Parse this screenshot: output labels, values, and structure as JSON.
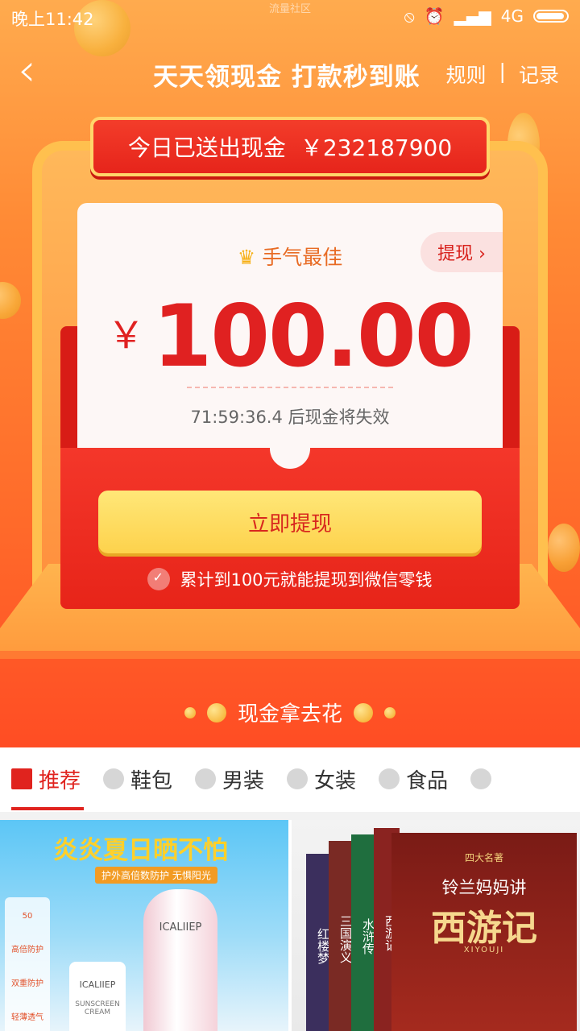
{
  "status_bar": {
    "time": "晚上11:42",
    "network_label": "流量社区",
    "signal": "4G"
  },
  "nav": {
    "back_icon": "back-chevron-icon",
    "title": "天天领现金 打款秒到账",
    "rules": "规则",
    "separator": "|",
    "records": "记录"
  },
  "banner": {
    "sent_label": "今日已送出现金",
    "sent_amount": "￥232187900",
    "best_label": "手气最佳",
    "withdraw_chip": "提现 ›",
    "currency": "￥",
    "amount": "100.00",
    "expire_text": "71:59:36.4 后现金将失效",
    "withdraw_button": "立即提现",
    "wechat_note": "累计到100元就能提现到微信零钱"
  },
  "spend_label": "现金拿去花",
  "tabs": [
    {
      "label": "推荐",
      "active": true
    },
    {
      "label": "鞋包",
      "active": false
    },
    {
      "label": "男装",
      "active": false
    },
    {
      "label": "女装",
      "active": false
    },
    {
      "label": "食品",
      "active": false
    }
  ],
  "products": {
    "left": {
      "headline": "炎炎夏日晒不怕",
      "subline": "护外高倍数防护 无惧阳光",
      "brand": "ICALIIEP",
      "tube_name": "SUNSCREEN CREAM",
      "badges": [
        "50",
        "高倍防护",
        "双重防护",
        "轻薄透气"
      ]
    },
    "right": {
      "series_tag": "四大名著",
      "subtitle": "铃兰妈妈讲",
      "title": "西游记",
      "pinyin": "XIYOUJI",
      "spines": [
        "红楼梦",
        "三国演义",
        "水浒传",
        "西游记"
      ]
    }
  },
  "colors": {
    "primary_red": "#e0231e",
    "gold": "#fdd24c",
    "hero_orange": "#ff8a35"
  }
}
